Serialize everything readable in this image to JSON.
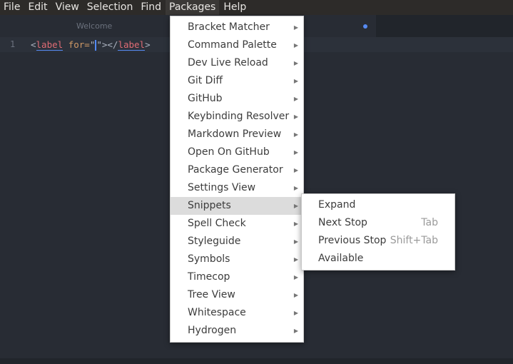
{
  "menubar": [
    "File",
    "Edit",
    "View",
    "Selection",
    "Find",
    "Packages",
    "Help"
  ],
  "tab": {
    "title": "Welcome"
  },
  "editor": {
    "line_number": "1",
    "code": {
      "open": "<",
      "tag": "label",
      "attr": " for=",
      "q1": "\"",
      "q2": "\"",
      "mid": "></",
      "tag2": "label",
      "close": ">"
    }
  },
  "packages_menu": [
    "Bracket Matcher",
    "Command Palette",
    "Dev Live Reload",
    "Git Diff",
    "GitHub",
    "Keybinding Resolver",
    "Markdown Preview",
    "Open On GitHub",
    "Package Generator",
    "Settings View",
    "Snippets",
    "Spell Check",
    "Styleguide",
    "Symbols",
    "Timecop",
    "Tree View",
    "Whitespace",
    "Hydrogen"
  ],
  "snippets_menu": [
    {
      "label": "Expand",
      "shortcut": ""
    },
    {
      "label": "Next Stop",
      "shortcut": "Tab"
    },
    {
      "label": "Previous Stop",
      "shortcut": "Shift+Tab"
    },
    {
      "label": "Available",
      "shortcut": ""
    }
  ]
}
